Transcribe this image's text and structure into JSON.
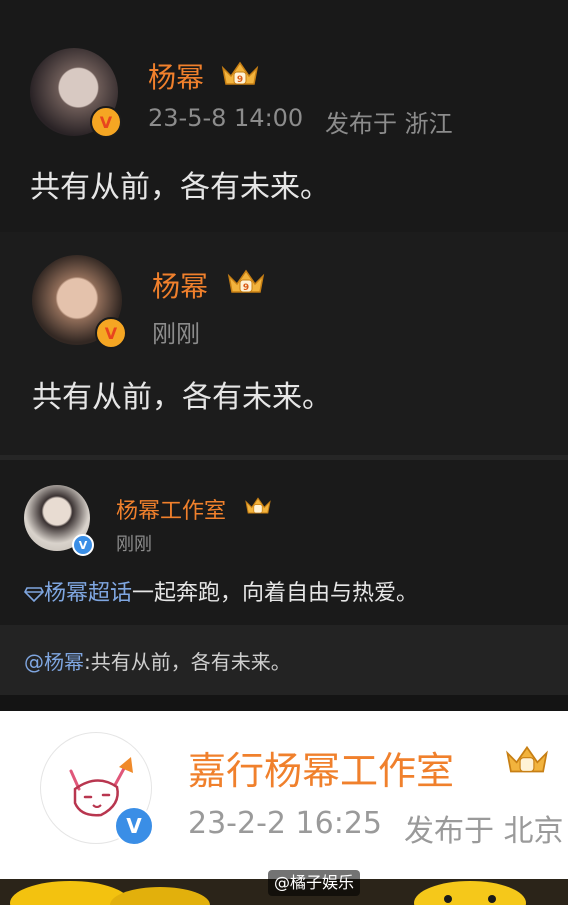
{
  "posts": [
    {
      "author": "杨幂",
      "meta_time": "23-5-8 14:00",
      "meta_location": "发布于 浙江",
      "content": "共有从前，各有未来。"
    },
    {
      "author": "杨幂",
      "meta_time": "刚刚",
      "content": "共有从前，各有未来。"
    }
  ],
  "repost": {
    "author": "杨幂工作室",
    "meta_time": "刚刚",
    "topic": "杨幂超话",
    "content": "一起奔跑，向着自由与热爱。",
    "quote_mention": "@杨幂",
    "quote_text": ":共有从前，各有未来。"
  },
  "bottom_card": {
    "author": "嘉行杨幂工作室",
    "meta_time": "23-2-2 16:25",
    "meta_location": "发布于 北京"
  },
  "watermark": "@橘子娱乐",
  "colors": {
    "name_orange": "#f0802c",
    "link_blue": "#7fa6e0",
    "verified_orange": "#f5a623",
    "verified_blue": "#3a8ee6"
  }
}
